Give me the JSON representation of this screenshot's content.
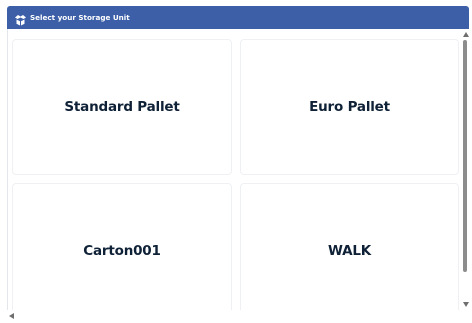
{
  "dialog": {
    "title": "Select your Storage Unit",
    "icon": "box-open-icon"
  },
  "storage_units": [
    {
      "label": "Standard Pallet"
    },
    {
      "label": "Euro Pallet"
    },
    {
      "label": "Carton001"
    },
    {
      "label": "WALK"
    }
  ],
  "colors": {
    "accent": "#3c5fa8",
    "card_text": "#0f2136"
  }
}
